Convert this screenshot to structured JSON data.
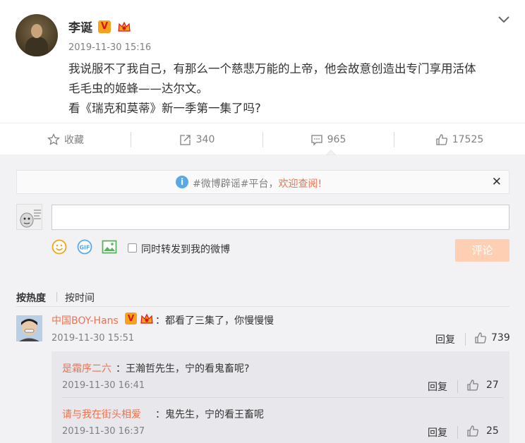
{
  "post": {
    "author": "李诞",
    "verified_badge": "V",
    "timestamp": "2019-11-30 15:16",
    "text_line1": "我说服不了我自己，有那么一个慈悲万能的上帝，他会故意创造出专门享用活体",
    "text_line2": "毛毛虫的姬蜂——达尔文。",
    "text_line3": "看《瑞克和莫蒂》新一季第一集了吗?"
  },
  "actions": {
    "favorite": "收藏",
    "repost_count": "340",
    "comment_count": "965",
    "like_count": "17525"
  },
  "notice": {
    "text": "#微博辟谣#平台，",
    "link": "欢迎查阅!",
    "close": "✕"
  },
  "composer": {
    "input_value": "",
    "sync_label": "同时转发到我的微博",
    "submit_label": "评论"
  },
  "sort": {
    "by_hot": "按热度",
    "by_time": "按时间"
  },
  "comment": {
    "user": "中国BOY-Hans",
    "text": "：都看了三集了，你慢慢慢",
    "time": "2019-11-30 15:51",
    "reply_label": "回复",
    "likes": "739"
  },
  "replies": [
    {
      "user": "是霜序二六",
      "text": "：王瀚哲先生，宁的看鬼畜呢?",
      "time": "2019-11-30 16:41",
      "reply_label": "回复",
      "likes": "27"
    },
    {
      "user": "请与我在街头相爱",
      "text": "：鬼先生，宁的看王畜呢",
      "time": "2019-11-30 16:37",
      "reply_label": "回复",
      "likes": "25"
    }
  ],
  "colors": {
    "accent_orange": "#eb7350",
    "submit_disabled": "#fecfb3",
    "background_gray": "#f2f2f5",
    "badge_gold": "#f7a21b"
  },
  "icons": {
    "favorite": "star-icon",
    "repost": "repost-icon",
    "comment": "comment-icon",
    "like": "thumbs-up-icon",
    "more": "chevron-down-icon",
    "emoji": "smile-icon",
    "gif": "gif-icon",
    "image": "image-icon",
    "info": "info-icon"
  }
}
